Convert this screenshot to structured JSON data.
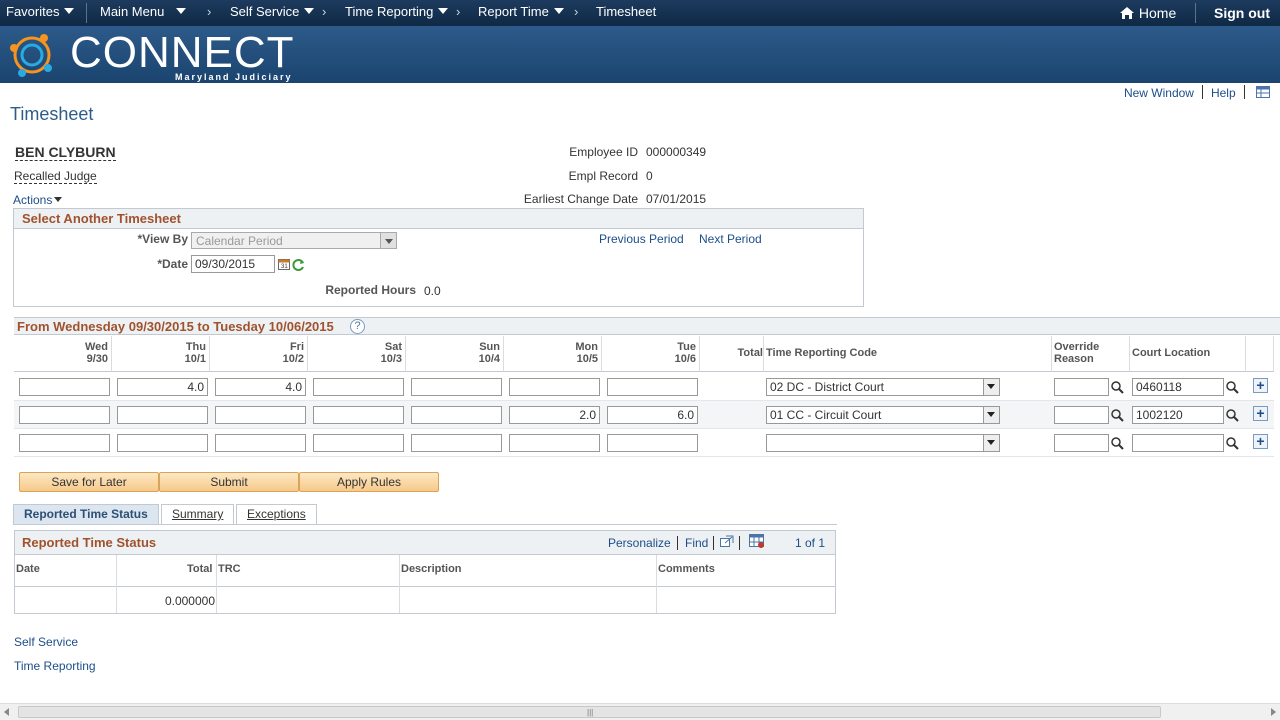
{
  "nav": {
    "favorites": "Favorites",
    "main_menu": "Main Menu",
    "breadcrumbs": [
      "Self Service",
      "Time Reporting",
      "Report Time",
      "Timesheet"
    ],
    "home": "Home",
    "sign_out": "Sign out"
  },
  "brand": {
    "name": "CONNECT",
    "subtitle": "Maryland Judiciary",
    "colors": [
      "#f7941d",
      "#29abe2",
      "#1d3b5f"
    ]
  },
  "header_links": {
    "new_window": "New Window",
    "help": "Help"
  },
  "page_title": "Timesheet",
  "employee": {
    "name": "BEN CLYBURN",
    "title": "Recalled Judge",
    "actions": "Actions",
    "id_label": "Employee ID",
    "id_value": "000000349",
    "record_label": "Empl Record",
    "record_value": "0",
    "change_label": "Earliest Change Date",
    "change_value": "07/01/2015"
  },
  "select_timesheet": {
    "title": "Select Another Timesheet",
    "view_by_label": "*View By",
    "view_by_value": "Calendar Period",
    "date_label": "*Date",
    "date_value": "09/30/2015",
    "previous_period": "Previous Period",
    "next_period": "Next Period",
    "reported_hours_label": "Reported Hours",
    "reported_hours_value": "0.0"
  },
  "grid": {
    "title": "From Wednesday 09/30/2015 to Tuesday 10/06/2015",
    "days": [
      {
        "day": "Wed",
        "date": "9/30"
      },
      {
        "day": "Thu",
        "date": "10/1"
      },
      {
        "day": "Fri",
        "date": "10/2"
      },
      {
        "day": "Sat",
        "date": "10/3"
      },
      {
        "day": "Sun",
        "date": "10/4"
      },
      {
        "day": "Mon",
        "date": "10/5"
      },
      {
        "day": "Tue",
        "date": "10/6"
      }
    ],
    "total_label": "Total",
    "trc_label": "Time Reporting Code",
    "override_label_1": "Override",
    "override_label_2": "Reason",
    "court_label": "Court Location",
    "rows": [
      {
        "hours": [
          "",
          "4.0",
          "4.0",
          "",
          "",
          "",
          ""
        ],
        "trc": "02 DC - District Court",
        "override": "",
        "court": "0460118"
      },
      {
        "hours": [
          "",
          "",
          "",
          "",
          "",
          "2.0",
          "6.0"
        ],
        "trc": "01 CC - Circuit Court",
        "override": "",
        "court": "1002120"
      },
      {
        "hours": [
          "",
          "",
          "",
          "",
          "",
          "",
          ""
        ],
        "trc": "",
        "override": "",
        "court": ""
      }
    ]
  },
  "buttons": {
    "save": "Save for Later",
    "submit": "Submit",
    "apply": "Apply Rules"
  },
  "tabs": {
    "reported": "Reported Time Status",
    "summary": "Summary",
    "exceptions": "Exceptions"
  },
  "rts": {
    "title": "Reported Time Status",
    "personalize": "Personalize",
    "find": "Find",
    "pager": "1 of 1",
    "cols": [
      "Date",
      "Total",
      "TRC",
      "Description",
      "Comments"
    ],
    "row_total": "0.000000"
  },
  "footer_links": [
    "Self Service",
    "Time Reporting"
  ]
}
